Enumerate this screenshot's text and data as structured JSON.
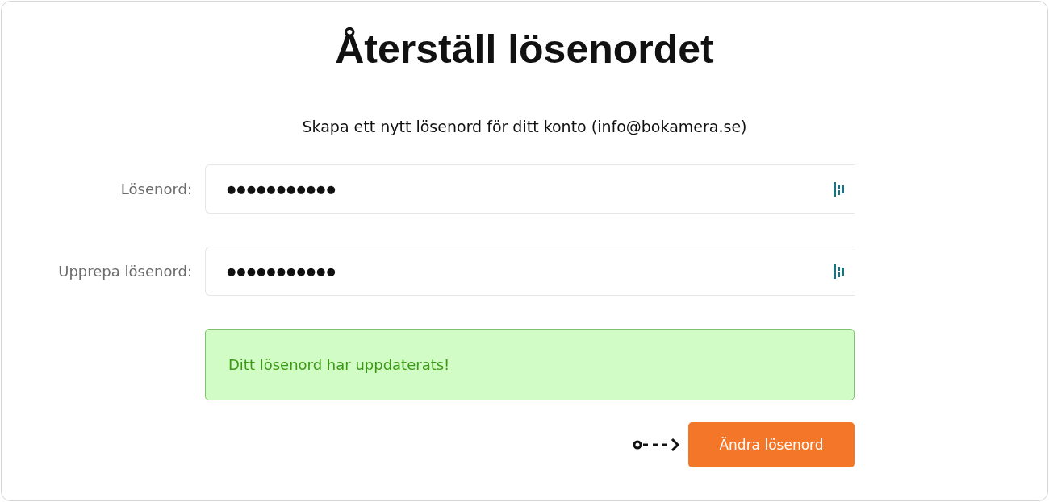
{
  "title": "Återställ lösenordet",
  "subtitle": "Skapa ett nytt lösenord för ditt konto (info@bokamera.se)",
  "fields": [
    {
      "label": "Lösenord:",
      "value": "●●●●●●●●●●●"
    },
    {
      "label": "Upprepa lösenord:",
      "value": "●●●●●●●●●●●"
    }
  ],
  "alert": {
    "kind": "success",
    "text": "Ditt lösenord har uppdaterats!"
  },
  "submit_button": "Ändra lösenord"
}
